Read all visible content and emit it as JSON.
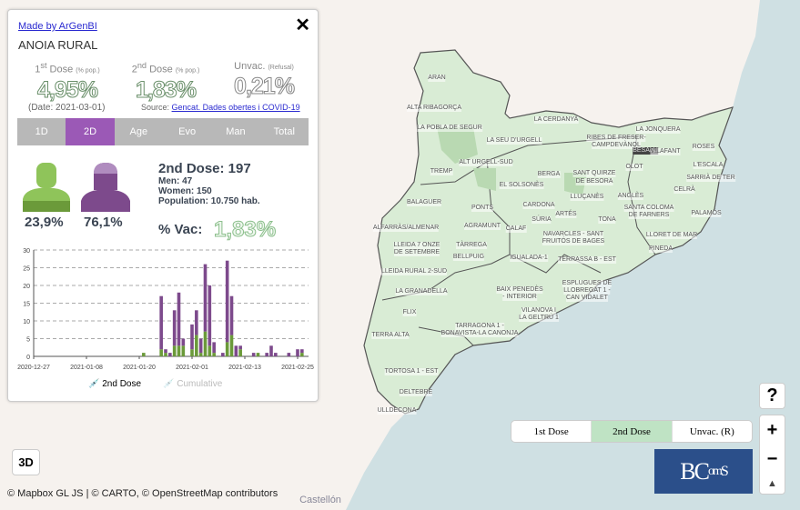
{
  "panel": {
    "made_by": "Made by ArGenBI",
    "region": "ANOIA RURAL",
    "stats": [
      {
        "title": "1",
        "sup": "st",
        "title_rest": " Dose",
        "unit": "(% pop.)",
        "value": "4,95%"
      },
      {
        "title": "2",
        "sup": "nd",
        "title_rest": " Dose",
        "unit": "(% pop.)",
        "value": "1,83%"
      },
      {
        "title": "Unvac.",
        "sup": "",
        "title_rest": "",
        "unit": "(Refusal)",
        "value": "0,21%"
      }
    ],
    "date": "(Date: 2021-03-01)",
    "source_label": "Source:",
    "source_link": "Gencat. Dades obertes i COVID-19",
    "tabs": [
      "1D",
      "2D",
      "Age",
      "Evo",
      "Man",
      "Total"
    ],
    "active_tab": "2D",
    "men_pct": "23,9%",
    "women_pct": "76,1%",
    "dose_title": "2nd Dose: 197",
    "men": "Men: 47",
    "women": "Women: 150",
    "population": "Population: 10.750 hab.",
    "vac_label": "% Vac:",
    "vac_value": "1,83%",
    "legend": [
      "2nd Dose",
      "Cumulative"
    ]
  },
  "chart_data": {
    "type": "bar",
    "stacked": true,
    "x_ticks": [
      "2020-12-27",
      "2021-01-08",
      "2021-01-20",
      "2021-02-01",
      "2021-02-13",
      "2021-02-25"
    ],
    "y_ticks": [
      "0",
      "5",
      "10",
      "15",
      "20",
      "25",
      "30"
    ],
    "ylim": [
      0,
      30
    ],
    "grid": "horizontal dashed",
    "dates": [
      "2021-01-21",
      "2021-01-25",
      "2021-01-26",
      "2021-01-27",
      "2021-01-28",
      "2021-01-29",
      "2021-01-30",
      "2021-02-01",
      "2021-02-02",
      "2021-02-03",
      "2021-02-04",
      "2021-02-05",
      "2021-02-06",
      "2021-02-08",
      "2021-02-09",
      "2021-02-10",
      "2021-02-11",
      "2021-02-12",
      "2021-02-15",
      "2021-02-16",
      "2021-02-18",
      "2021-02-19",
      "2021-02-20",
      "2021-02-23",
      "2021-02-25",
      "2021-02-26"
    ],
    "series": [
      {
        "color": "#6b9a3a",
        "values": [
          1,
          2,
          1,
          0,
          3,
          3,
          3,
          2,
          6,
          1,
          7,
          3,
          1,
          0,
          4,
          6,
          0,
          2,
          0,
          1,
          0,
          0,
          0,
          0,
          0,
          1
        ]
      },
      {
        "color": "#7d4a8c",
        "values": [
          0,
          15,
          1,
          1,
          10,
          15,
          2,
          7,
          7,
          4,
          19,
          17,
          3,
          1,
          23,
          11,
          3,
          1,
          1,
          0,
          1,
          3,
          1,
          1,
          2,
          1
        ]
      }
    ],
    "legend": [
      "2nd Dose",
      "Cumulative"
    ]
  },
  "map": {
    "labels": [
      "ARAN",
      "ALTA RIBAGORÇA",
      "LA POBLA DE SEGUR",
      "LA SEU D'URGELL",
      "LA CERDANYA",
      "RIBES DE FRESER-",
      "CAMPDEVÀNOL",
      "BESALÚ",
      "VILAFANT",
      "LA JONQUERA",
      "ROSES",
      "L'ESCALA",
      "OLOT",
      "SARRIÀ DE TER",
      "CELRÀ",
      "ALT URGELL-SUD",
      "TREMP",
      "BERGA",
      "SANT QUIRZE",
      "DE BESORA",
      "EL SOLSONÈS",
      "LLUÇANÈS",
      "ANGLÈS",
      "SANTA COLOMA",
      "DE FARNERS",
      "PALAMÓS",
      "BALAGUER",
      "PONTS",
      "CARDONA",
      "ARTÉS",
      "TONA",
      "SÚRIA",
      "CALAF",
      "ALFARRÀS/ALMENAR",
      "AGRAMUNT",
      "LLEIDA 7 ONZE",
      "DE SETEMBRE",
      "TÀRREGA",
      "BELLPUIG",
      "NAVARCLES - SANT",
      "FRUITÓS DE BAGES",
      "LLORET DE MAR",
      "PINEDA",
      "IGUALADA-1",
      "TERRASSA B - EST",
      "LLEIDA RURAL 2-SUD",
      "LA GRANADELLA",
      "BAIX PENEDÈS",
      "- INTERIOR",
      "ESPLUGUES DE",
      "LLOBREGAT 1 -",
      "CAN VIDALET",
      "FLIX",
      "VILANOVA I",
      "LA GELTRÚ 1",
      "TARRAGONA 1 -",
      "BONAVISTA-LA CANONJA",
      "TERRA ALTA",
      "TORTOSA 1 - EST",
      "DELTEBRE",
      "ULLDECONA",
      "Castellón"
    ],
    "mode_buttons": [
      "1st Dose",
      "2nd Dose",
      "Unvac. (R)"
    ],
    "active_mode": "2nd Dose",
    "help": "?",
    "zoom_in": "+",
    "zoom_out": "−",
    "compass": "▲",
    "btn_3d": "3D",
    "logo": "BioComSC",
    "attribution": "© Mapbox GL JS | © CARTO, © OpenStreetMap contributors",
    "colors": {
      "land": "#f6f2ee",
      "sea": "#cfe0e3",
      "region_fill": "#d9ecd5",
      "accent": "#9b59b6"
    }
  }
}
